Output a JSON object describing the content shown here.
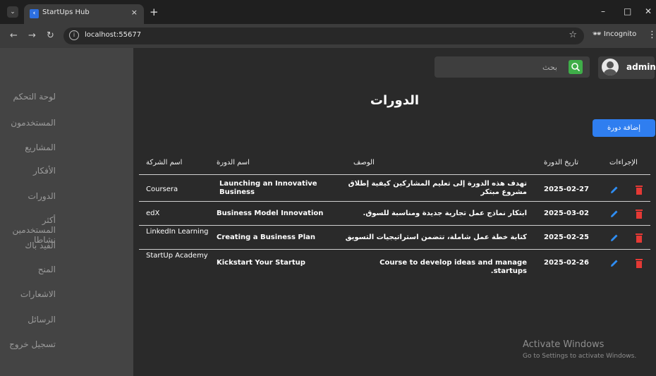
{
  "browser": {
    "tab_title": "StartUps Hub",
    "tab_close": "×",
    "new_tab": "+",
    "url": "localhost:55677",
    "incognito_label": "Incognito",
    "minimize": "–",
    "maximize": "□",
    "close": "✕"
  },
  "sidebar": {
    "items": [
      {
        "label": "لوحة التحكم"
      },
      {
        "label": "المستخدمون"
      },
      {
        "label": "المشاريع"
      },
      {
        "label": "الأفكار"
      },
      {
        "label": "الدورات"
      },
      {
        "label": "أكثر المستخدمين نشاطا"
      },
      {
        "label": "الفيد باك"
      },
      {
        "label": "المنح"
      },
      {
        "label": "الاشعارات"
      },
      {
        "label": "الرسائل"
      },
      {
        "label": "تسجيل خروج"
      }
    ]
  },
  "header": {
    "search_placeholder": "بحث",
    "user_name": "admin"
  },
  "main": {
    "title": "الدورات",
    "add_button": "إضافة دورة",
    "columns": {
      "company": "اسم الشركة",
      "course": "اسم الدورة",
      "description": "الوصف",
      "date": "تاريخ الدورة",
      "actions": "الإجراءات"
    },
    "rows": [
      {
        "company": "Coursera",
        "course": "Launching an Innovative Business",
        "description": "تهدف هذه الدورة إلى تعليم المشاركين كيفية إطلاق مشروع مبتكر",
        "date": "2025-02-27"
      },
      {
        "company": "edX",
        "course": "Business Model Innovation",
        "description": "ابتكار نماذج عمل تجارية جديدة ومناسبة للسوق.",
        "date": "2025-03-02"
      },
      {
        "company": "LinkedIn Learning",
        "course": "Creating a Business Plan",
        "description": "كتابة خطة عمل شاملة، تتضمن استراتيجيات التسويق",
        "date": "2025-02-25"
      },
      {
        "company": "StartUp Academy",
        "course": "Kickstart Your Startup",
        "description": "Course to develop ideas and manage startups.",
        "date": "2025-02-26"
      }
    ]
  },
  "watermark": {
    "line1": "Activate Windows",
    "line2": "Go to Settings to activate Windows."
  },
  "colors": {
    "sidebar_bg": "#444444",
    "main_bg": "#2a2a2a",
    "accent_blue": "#2f7ef0",
    "search_green": "#3fae49",
    "edit_icon": "#2f8ef5",
    "delete_icon": "#e53935"
  }
}
